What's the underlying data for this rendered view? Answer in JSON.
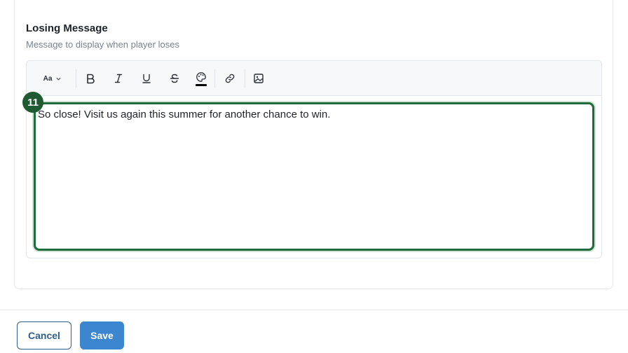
{
  "field": {
    "label": "Losing Message",
    "description": "Message to display when player loses"
  },
  "toolbar": {
    "font_size_label": "Aa",
    "items": [
      "font-size-icon",
      "bold-icon",
      "italic-icon",
      "underline-icon",
      "strikethrough-icon",
      "text-color-icon",
      "link-icon",
      "image-icon"
    ]
  },
  "editor": {
    "content": "So close! Visit us again this summer for another chance to win.",
    "step_badge": "11",
    "focus_color": "#1f6b3b"
  },
  "footer": {
    "cancel_label": "Cancel",
    "save_label": "Save"
  },
  "colors": {
    "primary": "#3b86cf",
    "badge": "#1f5a33"
  }
}
